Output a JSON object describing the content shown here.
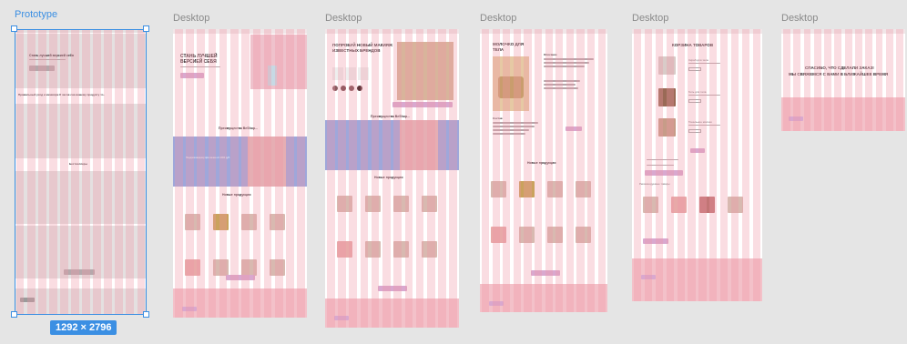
{
  "frames": [
    {
      "title": "Prototype",
      "selected": true
    },
    {
      "title": "Desktop"
    },
    {
      "title": "Desktop"
    },
    {
      "title": "Desktop"
    },
    {
      "title": "Desktop"
    },
    {
      "title": "Desktop"
    }
  ],
  "selection_size": "1292 × 2796",
  "f1": {
    "hero": "Стань лучшей версией себя",
    "section": "Правильный уход и минимум 8 часов сна вашему продукту то..",
    "best": "Бестселлеры",
    "more": "Показать ещё"
  },
  "f2": {
    "hero_line1": "СТАНЬ ЛУЧШЕЙ",
    "hero_line2": "ВЕРСИЕЙ СЕБЯ",
    "adv": "Преимущества BeShop...",
    "new": "Новые продукции",
    "banner": "Подарок каждому при заказе от 2000 руб."
  },
  "f3": {
    "hero_line1": "ПОПРОБУЙ НОВЫЙ МАКИЯЖ",
    "hero_line2": "ИЗВЕСТНЫХ БРЕНДОВ",
    "adv": "Преимущества BeShop...",
    "new": "Новые продукции"
  },
  "f4": {
    "title_line1": "МОЛОЧКО ДЛЯ",
    "title_line2": "ТЕЛА",
    "description": "Описание",
    "composition": "Состав",
    "new": "Новые продукции"
  },
  "f5": {
    "cart": "КОРЗИНА ТОВАРОВ",
    "item1": "Скраб для тела",
    "item2": "Гель для тела",
    "item3": "Тональное молоко",
    "recommend": "Рекомендуемые товары"
  },
  "f6": {
    "thanks_line1": "СПАСИБО, ЧТО СДЕЛАЛИ ЗАКАЗ!",
    "thanks_line2": "МЫ СВЯЖЕМСЯ С ВАМИ В БЛИЖАЙШЕЕ ВРЕМЯ"
  }
}
